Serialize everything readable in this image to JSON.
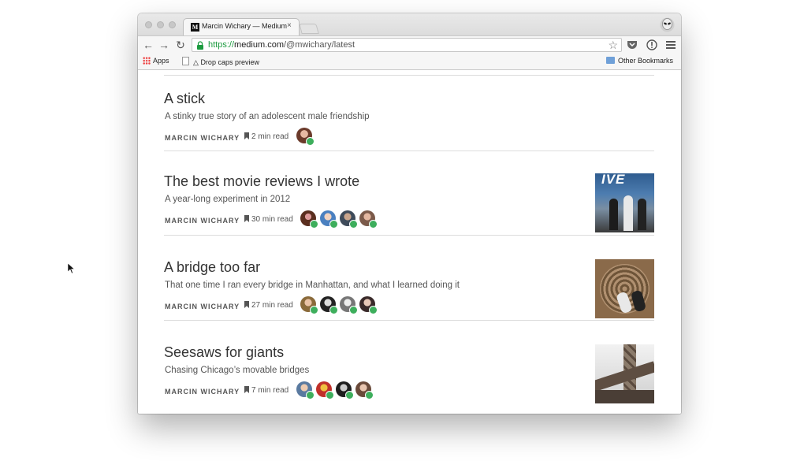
{
  "browser": {
    "tab_title": "Marcin Wichary — Medium",
    "tab_close": "×",
    "url_scheme": "https://",
    "url_host": "medium.com",
    "url_path": "/@mwichary/latest",
    "bookmarks": {
      "apps": "Apps",
      "drop_caps": "Drop caps preview",
      "other": "Other Bookmarks"
    }
  },
  "colors": {
    "secure_green": "#1c9b3f",
    "recommend_green": "#3dae5c",
    "divider": "#dcdcdc"
  },
  "posts": [
    {
      "title": "A stick",
      "subtitle": "A stinky true story of an adolescent male friendship",
      "author": "MARCIN WICHARY",
      "read_time": "2 min read",
      "recommenders": 1,
      "has_thumbnail": false
    },
    {
      "title": "The best movie reviews I wrote",
      "subtitle": "A year-long experiment in 2012",
      "author": "MARCIN WICHARY",
      "read_time": "30 min read",
      "recommenders": 4,
      "has_thumbnail": true,
      "thumbnail_text": "IVE"
    },
    {
      "title": "A bridge too far",
      "subtitle": "That one time I ran every bridge in Manhattan, and what I learned doing it",
      "author": "MARCIN WICHARY",
      "read_time": "27 min read",
      "recommenders": 4,
      "has_thumbnail": true
    },
    {
      "title": "Seesaws for giants",
      "subtitle": "Chasing Chicago’s movable bridges",
      "author": "MARCIN WICHARY",
      "read_time": "7 min read",
      "recommenders": 4,
      "has_thumbnail": true
    }
  ]
}
